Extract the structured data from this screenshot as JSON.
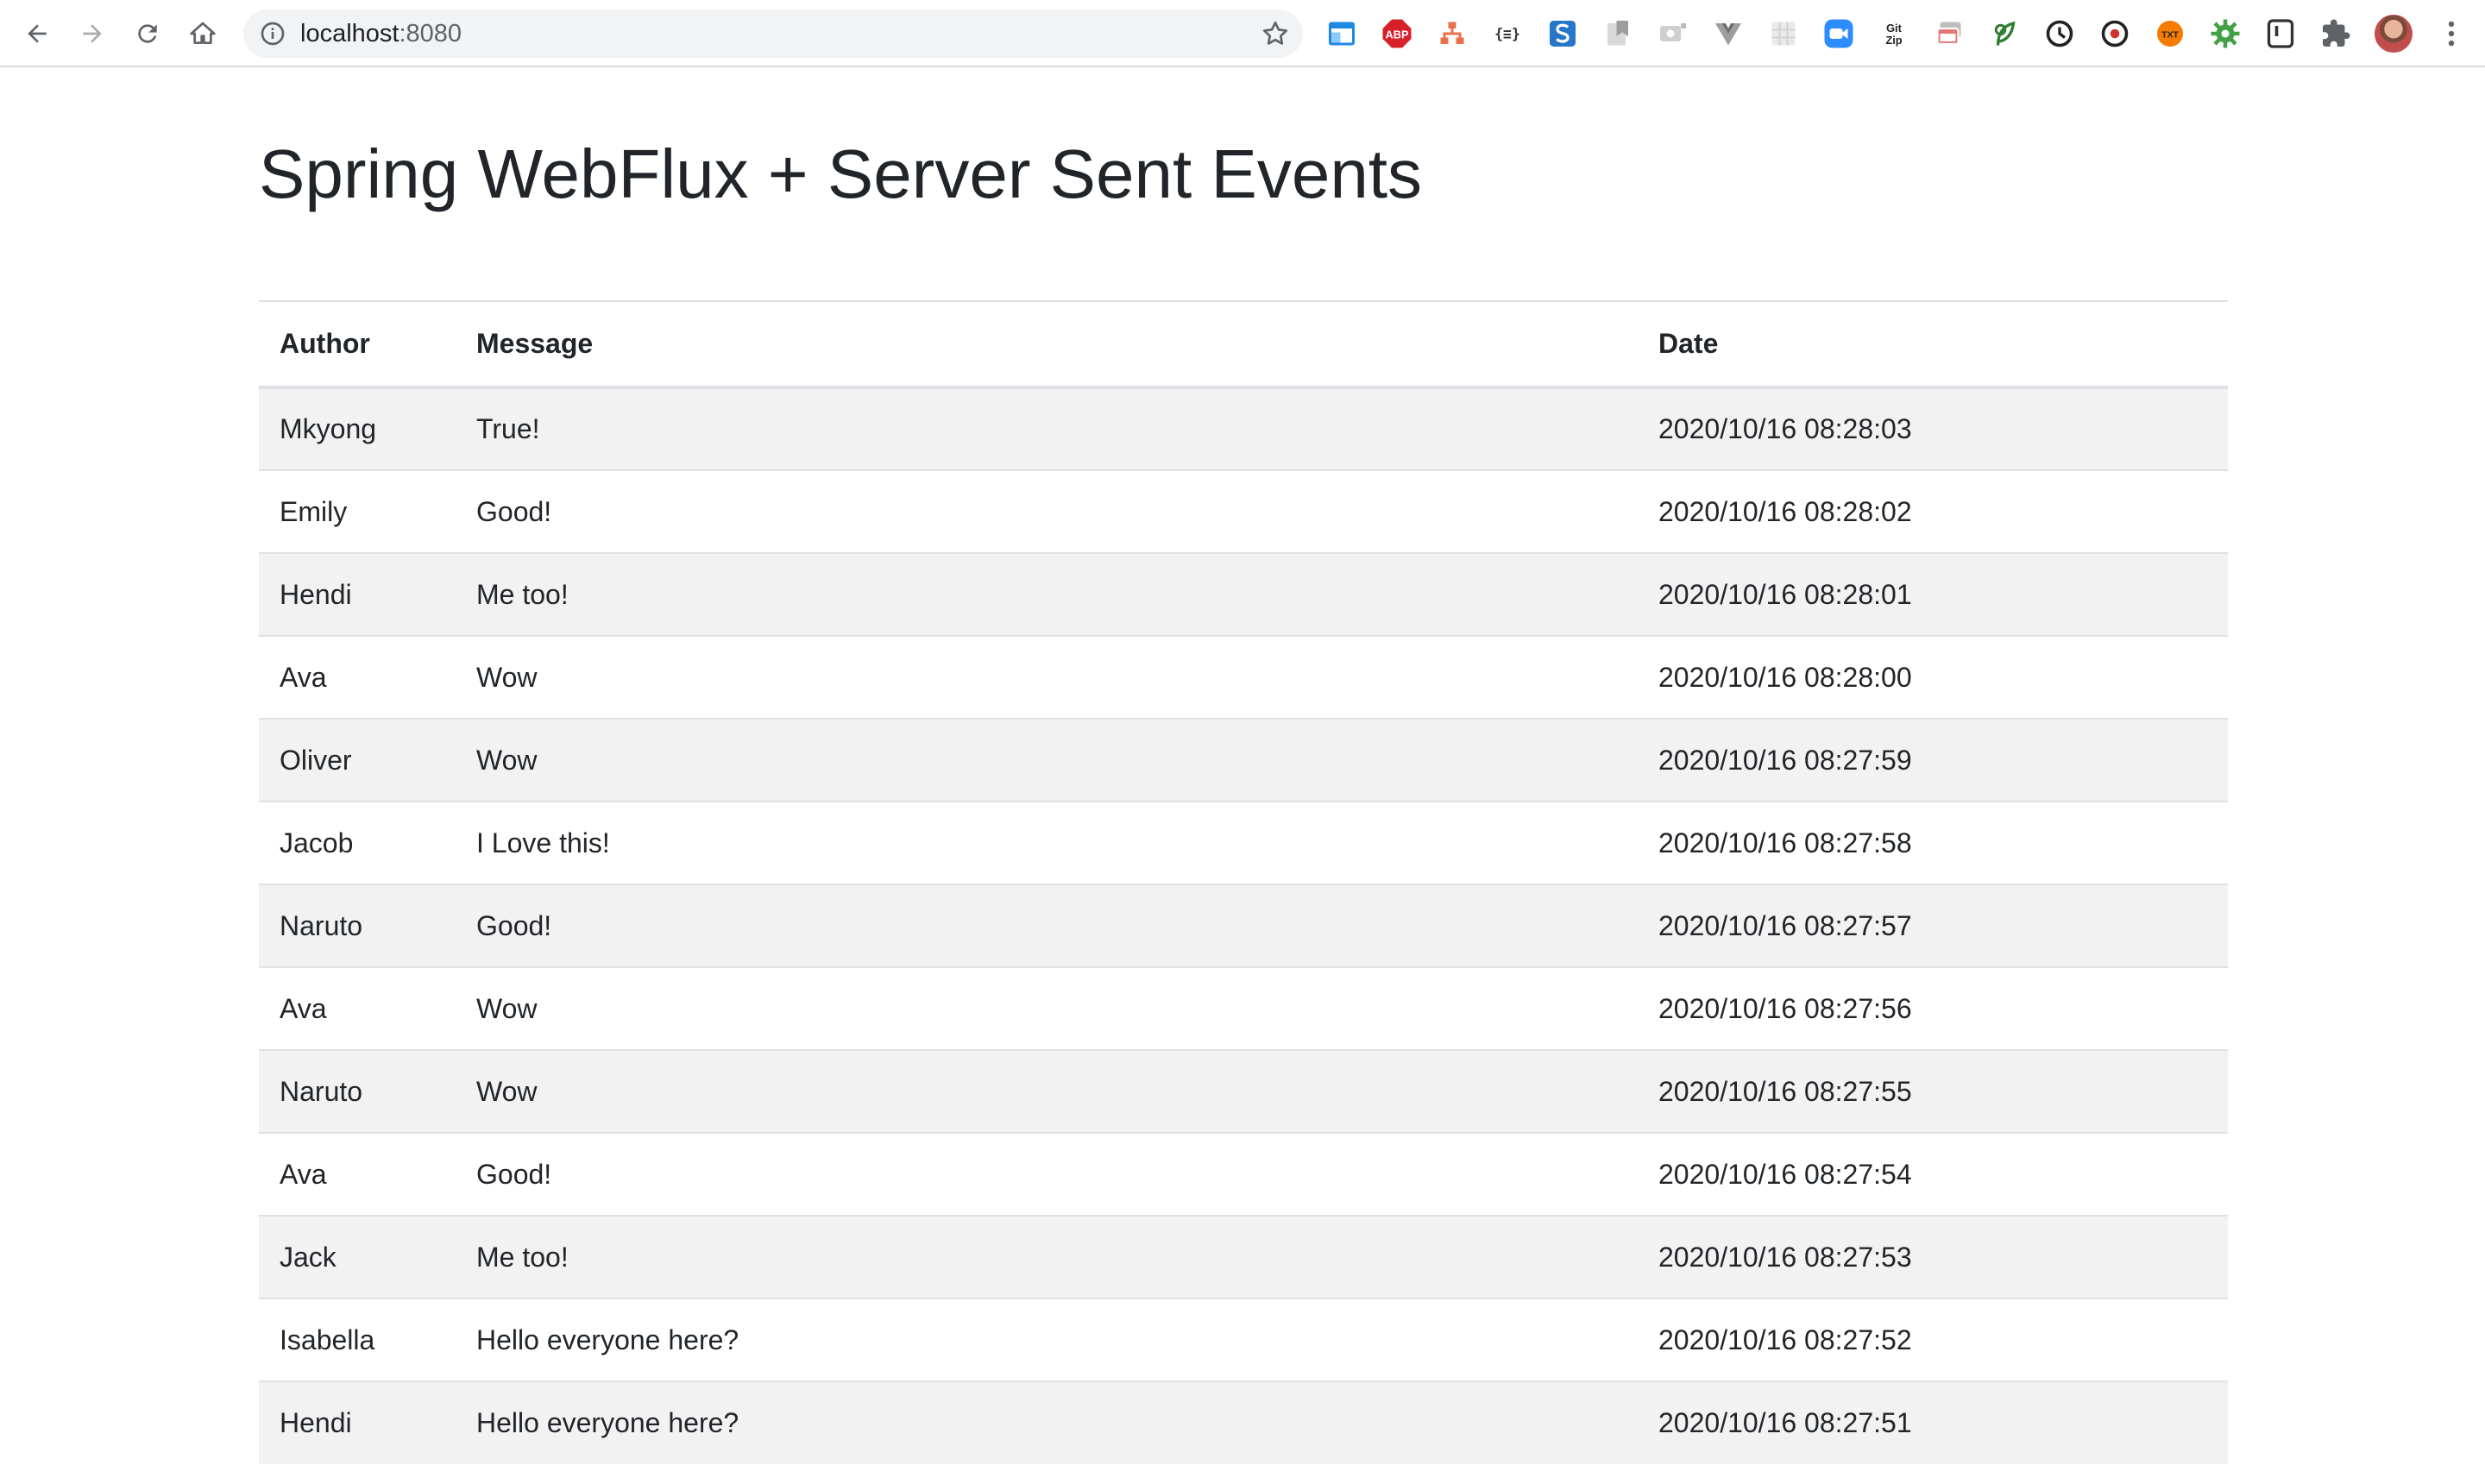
{
  "browser": {
    "url_host": "localhost",
    "url_port": ":8080",
    "extensions": [
      "window-icon",
      "adblock-plus-icon",
      "network-icon",
      "json-formatter-icon",
      "s-extension-icon",
      "bookmark-extension-icon",
      "screen-capture-icon",
      "vue-devtools-icon",
      "grid-extension-icon",
      "zoom-icon",
      "gitzip-icon",
      "tab-manager-icon",
      "leaf-extension-icon",
      "clock-extension-icon",
      "refresh-extension-icon",
      "text-extension-icon",
      "gear-extension-icon",
      "u-extension-icon",
      "extensions-puzzle-icon"
    ],
    "colors": {
      "omnibox_bg": "#f1f3f4",
      "toolbar_icon": "#5f6368"
    }
  },
  "page": {
    "title": "Spring WebFlux + Server Sent Events",
    "table": {
      "headers": {
        "author": "Author",
        "message": "Message",
        "date": "Date"
      },
      "rows": [
        {
          "author": "Mkyong",
          "message": "True!",
          "date": "2020/10/16 08:28:03"
        },
        {
          "author": "Emily",
          "message": "Good!",
          "date": "2020/10/16 08:28:02"
        },
        {
          "author": "Hendi",
          "message": "Me too!",
          "date": "2020/10/16 08:28:01"
        },
        {
          "author": "Ava",
          "message": "Wow",
          "date": "2020/10/16 08:28:00"
        },
        {
          "author": "Oliver",
          "message": "Wow",
          "date": "2020/10/16 08:27:59"
        },
        {
          "author": "Jacob",
          "message": "I Love this!",
          "date": "2020/10/16 08:27:58"
        },
        {
          "author": "Naruto",
          "message": "Good!",
          "date": "2020/10/16 08:27:57"
        },
        {
          "author": "Ava",
          "message": "Wow",
          "date": "2020/10/16 08:27:56"
        },
        {
          "author": "Naruto",
          "message": "Wow",
          "date": "2020/10/16 08:27:55"
        },
        {
          "author": "Ava",
          "message": "Good!",
          "date": "2020/10/16 08:27:54"
        },
        {
          "author": "Jack",
          "message": "Me too!",
          "date": "2020/10/16 08:27:53"
        },
        {
          "author": "Isabella",
          "message": "Hello everyone here?",
          "date": "2020/10/16 08:27:52"
        },
        {
          "author": "Hendi",
          "message": "Hello everyone here?",
          "date": "2020/10/16 08:27:51"
        }
      ],
      "colors": {
        "stripe": "#f2f2f2",
        "border": "#dee2e6",
        "text": "#212529"
      }
    }
  }
}
